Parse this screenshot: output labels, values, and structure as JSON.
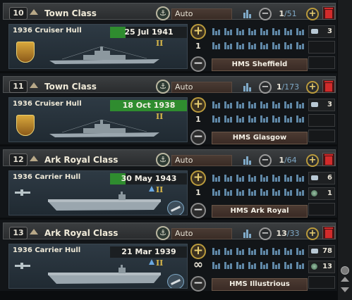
{
  "items": [
    {
      "index": "10",
      "class": "Town Class",
      "production_mode": "Auto",
      "count": "1",
      "total": "/51",
      "hull": "1936 Cruiser Hull",
      "date": "25 Jul 1941",
      "rank": "II",
      "amount": "1",
      "ship_name": "HMS Sheffield",
      "res1": "3",
      "res2": "",
      "type": "cruiser",
      "progress": 0.2
    },
    {
      "index": "11",
      "class": "Town Class",
      "production_mode": "Auto",
      "count": "1",
      "total": "/173",
      "hull": "1936 Cruiser Hull",
      "date": "18 Oct 1938",
      "rank": "II",
      "amount": "1",
      "ship_name": "HMS Glasgow",
      "res1": "3",
      "res2": "",
      "type": "cruiser",
      "progress": 1.0
    },
    {
      "index": "12",
      "class": "Ark Royal Class",
      "production_mode": "Auto",
      "count": "1",
      "total": "/64",
      "hull": "1936 Carrier Hull",
      "date": "30 May 1943",
      "rank": "II",
      "amount": "1",
      "ship_name": "HMS Ark Royal",
      "res1": "6",
      "res2": "1",
      "type": "carrier",
      "progress": 0.2
    },
    {
      "index": "13",
      "class": "Ark Royal Class",
      "production_mode": "Auto",
      "count": "13",
      "total": "/33",
      "hull": "1936 Carrier Hull",
      "date": "21 Mar 1939",
      "rank": "II",
      "amount": "∞",
      "ship_name": "HMS Illustrious",
      "res1": "78",
      "res2": "13",
      "type": "carrier",
      "progress": 0.0
    }
  ],
  "icons": {
    "priority": "triangle-up-icon",
    "anchor": "anchor-icon",
    "dockyard": "dockyard-icon",
    "decrease": "minus-icon",
    "increase": "plus-icon",
    "delete": "trash-icon",
    "steel": "steel-icon",
    "chromium": "chromium-icon"
  },
  "colors": {
    "progress": "#2f8c2f",
    "delete": "#d22b2b",
    "gold": "#e9cf72",
    "dock_blue": "#7fa9c7"
  }
}
